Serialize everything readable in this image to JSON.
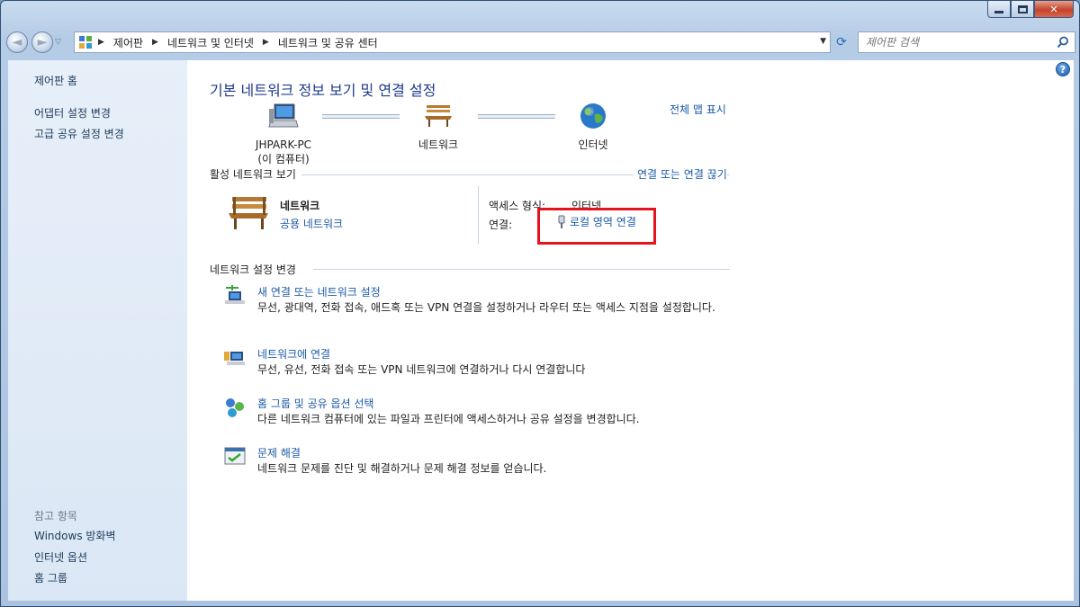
{
  "window": {
    "minimize_icon": "minimize-icon",
    "maximize_icon": "maximize-icon",
    "close_icon": "close-icon",
    "close_glyph": "✕"
  },
  "nav": {
    "back_glyph": "◄",
    "forward_glyph": "►",
    "history_glyph": "▽",
    "breadcrumbs": [
      "제어판",
      "네트워크 및 인터넷",
      "네트워크 및 공유 센터"
    ],
    "crumb_sep": "▶",
    "dropdown_glyph": "▼",
    "refresh_glyph": "⟳",
    "search_placeholder": "제어판 검색"
  },
  "sidebar": {
    "home": "제어판 홈",
    "adapter": "어댑터 설정 변경",
    "advanced": "고급 공유 설정 변경",
    "see_also": "참고 항목",
    "firewall": "Windows 방화벽",
    "internet_options": "인터넷 옵션",
    "homegroup": "홈 그룹"
  },
  "main": {
    "title": "기본 네트워크 정보 보기 및 연결 설정",
    "full_map": "전체 맵 표시",
    "map": {
      "pc_name": "JHPARK-PC",
      "pc_sub": "(이 컴퓨터)",
      "network": "네트워크",
      "internet": "인터넷"
    },
    "active_header": "활성 네트워크 보기",
    "connect_disconnect": "연결 또는 연결 끊기",
    "active": {
      "name": "네트워크",
      "type": "공용 네트워크",
      "access_label": "액세스 형식:",
      "access_value": "인터넷",
      "conn_label": "연결:",
      "conn_value": "로컬 영역 연결"
    },
    "change_header": "네트워크 설정 변경",
    "tasks": [
      {
        "link": "새 연결 또는 네트워크 설정",
        "desc": "무선, 광대역, 전화 접속, 애드혹 또는 VPN 연결을 설정하거나 라우터 또는 액세스 지점을 설정합니다."
      },
      {
        "link": "네트워크에 연결",
        "desc": "무선, 유선, 전화 접속 또는 VPN 네트워크에 연결하거나 다시 연결합니다"
      },
      {
        "link": "홈 그룹 및 공유 옵션 선택",
        "desc": "다른 네트워크 컴퓨터에 있는 파일과 프린터에 액세스하거나 공유 설정을 변경합니다."
      },
      {
        "link": "문제 해결",
        "desc": "네트워크 문제를 진단 및 해결하거나 문제 해결 정보를 얻습니다."
      }
    ]
  },
  "help_glyph": "?",
  "colors": {
    "link": "#1b5aa8",
    "title": "#1e3a8a",
    "highlight": "#e3141e"
  }
}
